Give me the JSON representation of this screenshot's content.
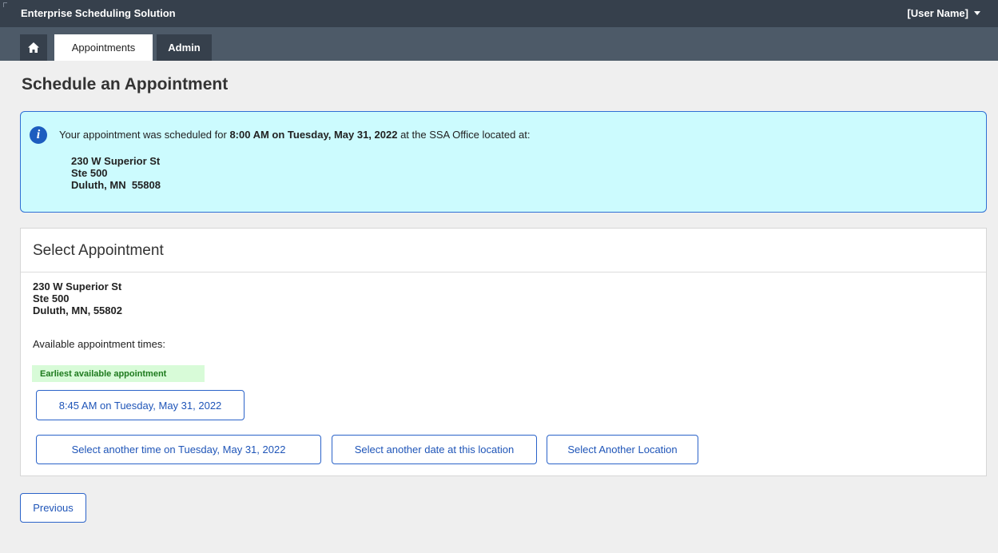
{
  "app": {
    "title": "Enterprise Scheduling Solution",
    "user_menu": "[User Name]"
  },
  "nav": {
    "home_icon": "home-icon",
    "tabs": [
      {
        "label": "Appointments",
        "active": true
      },
      {
        "label": "Admin",
        "active": false
      }
    ]
  },
  "page": {
    "title": "Schedule an Appointment"
  },
  "alert": {
    "icon": "info-icon",
    "prefix": "Your appointment was scheduled for ",
    "datetime": "8:00 AM on Tuesday, May 31, 2022",
    "suffix": " at the SSA Office located at:",
    "address": {
      "line1": "230 W Superior St",
      "line2": "Ste 500",
      "line3": "Duluth, MN  55808"
    }
  },
  "panel": {
    "title": "Select Appointment",
    "address": {
      "line1": "230 W Superior St",
      "line2": "Ste 500",
      "line3": "Duluth, MN, 55802"
    },
    "available_label": "Available appointment times:",
    "earliest_badge": "Earliest available appointment",
    "earliest_slot": "8:45 AM on Tuesday, May 31, 2022",
    "another_time": "Select another time on Tuesday, May 31, 2022",
    "another_date": "Select another date at this location",
    "another_location": "Select  Another Location"
  },
  "footer": {
    "previous": "Previous"
  },
  "colors": {
    "topbar": "#36404c",
    "navbar": "#4d5a68",
    "alert_bg": "#ccfbfe",
    "link_blue": "#1f55b8",
    "badge_bg": "#d8fbd8"
  }
}
